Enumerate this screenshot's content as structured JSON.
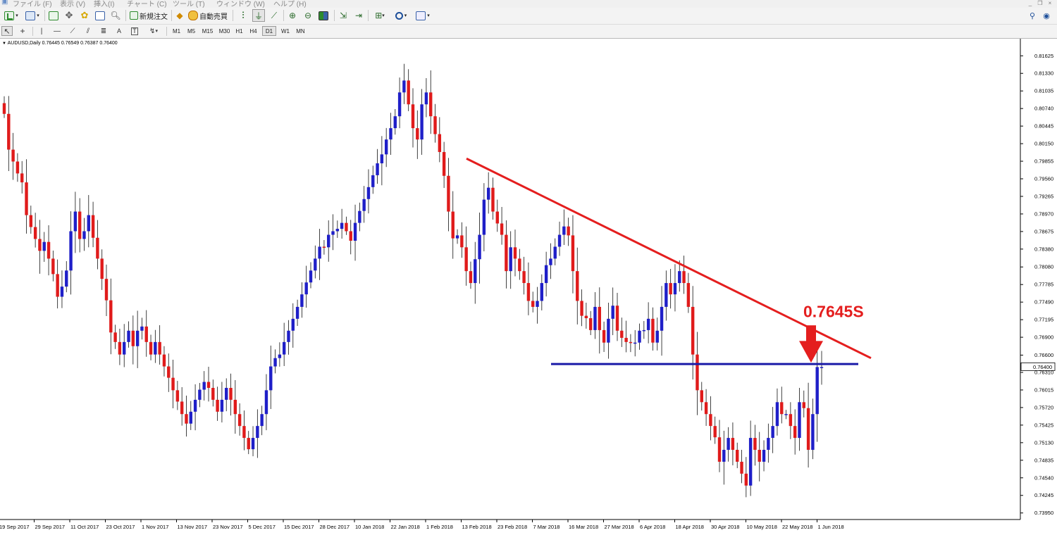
{
  "menubar": {
    "items": [
      "ファイル (F)",
      "表示 (V)",
      "挿入(I)",
      "チャート (C)",
      "ツール (T)",
      "ウィンドウ (W)",
      "ヘルプ (H)"
    ]
  },
  "toolbar": {
    "new_order_label": "新規注文",
    "auto_trade_label": "自動売買"
  },
  "timeframes": [
    "M1",
    "M5",
    "M15",
    "M30",
    "H1",
    "H4",
    "D1",
    "W1",
    "MN"
  ],
  "active_timeframe": "D1",
  "chart_window": {
    "header": "AUDUSD,Daily  0.76445 0.76549 0.76387 0.76400"
  },
  "colors": {
    "bull_candle": "#1f1fc8",
    "bear_candle": "#e01b1b",
    "trendline": "#e41e1e",
    "support_line": "#1a1aa8",
    "annotation": "#e41e1e"
  },
  "chart_data": {
    "type": "candlestick",
    "symbol": "AUDUSD",
    "timeframe": "Daily",
    "ohlc_header": {
      "open": 0.76445,
      "high": 0.76549,
      "low": 0.76387,
      "close": 0.764
    },
    "current_price": "0.76400",
    "ylim": [
      0.7384,
      0.8177
    ],
    "y_ticks": [
      "0.81625",
      "0.81330",
      "0.81035",
      "0.80740",
      "0.80445",
      "0.80150",
      "0.79855",
      "0.79560",
      "0.79265",
      "0.78970",
      "0.78675",
      "0.78380",
      "0.78080",
      "0.77785",
      "0.77490",
      "0.77195",
      "0.76900",
      "0.76600",
      "0.76310",
      "0.76015",
      "0.75720",
      "0.75425",
      "0.75130",
      "0.74835",
      "0.74540",
      "0.74245",
      "0.73950"
    ],
    "x_ticks": [
      "19 Sep 2017",
      "29 Sep 2017",
      "11 Oct 2017",
      "23 Oct 2017",
      "1 Nov 2017",
      "13 Nov 2017",
      "23 Nov 2017",
      "5 Dec 2017",
      "15 Dec 2017",
      "28 Dec 2017",
      "10 Jan 2018",
      "22 Jan 2018",
      "1 Feb 2018",
      "13 Feb 2018",
      "23 Feb 2018",
      "7 Mar 2018",
      "16 Mar 2018",
      "27 Mar 2018",
      "6 Apr 2018",
      "18 Apr 2018",
      "30 Apr 2018",
      "10 May 2018",
      "22 May 2018",
      "1 Jun 2018"
    ],
    "closes": [
      0.8065,
      0.8005,
      0.7985,
      0.7965,
      0.795,
      0.7895,
      0.7875,
      0.7855,
      0.7835,
      0.785,
      0.7822,
      0.7796,
      0.7758,
      0.7775,
      0.7802,
      0.7868,
      0.7901,
      0.7855,
      0.7868,
      0.7895,
      0.7857,
      0.7822,
      0.7788,
      0.7752,
      0.7698,
      0.7682,
      0.7661,
      0.7682,
      0.7701,
      0.7675,
      0.7701,
      0.7708,
      0.7682,
      0.7661,
      0.7682,
      0.7661,
      0.7641,
      0.7622,
      0.7601,
      0.7582,
      0.7561,
      0.7545,
      0.7565,
      0.7585,
      0.7602,
      0.7615,
      0.7605,
      0.7585,
      0.7565,
      0.7585,
      0.7605,
      0.7585,
      0.7561,
      0.7541,
      0.7521,
      0.7502,
      0.7521,
      0.7541,
      0.7561,
      0.7601,
      0.7641,
      0.7655,
      0.7661,
      0.7682,
      0.7701,
      0.7721,
      0.7741,
      0.7762,
      0.7782,
      0.7802,
      0.7822,
      0.7842,
      0.7841,
      0.7862,
      0.7868,
      0.7872,
      0.7882,
      0.7868,
      0.7852,
      0.7882,
      0.7902,
      0.7922,
      0.7942,
      0.7962,
      0.7982,
      0.7997,
      0.8022,
      0.8041,
      0.8061,
      0.8101,
      0.8121,
      0.8081,
      0.8041,
      0.8022,
      0.8081,
      0.8101,
      0.8061,
      0.8031,
      0.8001,
      0.7961,
      0.7901,
      0.7856,
      0.7861,
      0.7841,
      0.7801,
      0.7781,
      0.7821,
      0.7862,
      0.7921,
      0.7941,
      0.7901,
      0.7881,
      0.7862,
      0.7801,
      0.7841,
      0.7822,
      0.7801,
      0.7781,
      0.7751,
      0.7741,
      0.7751,
      0.7781,
      0.7811,
      0.7822,
      0.7842,
      0.7862,
      0.7876,
      0.7861,
      0.7801,
      0.7751,
      0.7726,
      0.7722,
      0.7702,
      0.7741,
      0.7702,
      0.7681,
      0.7721,
      0.7743,
      0.7701,
      0.7689,
      0.7682,
      0.7681,
      0.7681,
      0.7701,
      0.7702,
      0.7721,
      0.7681,
      0.7701,
      0.7741,
      0.7781,
      0.7762,
      0.7781,
      0.7801,
      0.7781,
      0.7741,
      0.7661,
      0.7601,
      0.7581,
      0.7561,
      0.7541,
      0.7522,
      0.7481,
      0.7501,
      0.7521,
      0.7501,
      0.7481,
      0.7461,
      0.7441,
      0.7521,
      0.7501,
      0.7481,
      0.7501,
      0.7521,
      0.7541,
      0.7581,
      0.7561,
      0.7561,
      0.7541,
      0.7521,
      0.7581,
      0.7571,
      0.7501,
      0.7561,
      0.764,
      0.764
    ]
  },
  "annotations": {
    "resistance_label": "0.7645S"
  }
}
